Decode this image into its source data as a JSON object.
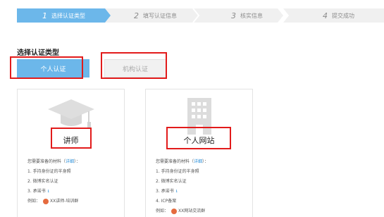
{
  "steps": [
    {
      "num": "1",
      "label": "选择认证类型",
      "active": true
    },
    {
      "num": "2",
      "label": "填写认证信息",
      "active": false
    },
    {
      "num": "3",
      "label": "核实信息",
      "active": false
    },
    {
      "num": "4",
      "label": "提交成功",
      "active": false
    }
  ],
  "colors": {
    "accent": "#6cb7ea",
    "highlight": "#e21b1b",
    "link": "#2b8fd8"
  },
  "section_title": "选择认证类型",
  "type_tabs": {
    "personal": "个人认证",
    "organization": "机构认证"
  },
  "cards": [
    {
      "icon": "graduation-cap-icon",
      "title": "讲师",
      "materials_prefix": "您需要准备的材料（",
      "detail_link": "详细",
      "materials_suffix": "）：",
      "items": [
        "1. 手持身份证的半身照",
        "2. 微博实名认证",
        "3. 承诺书"
      ],
      "example_label": "例如：",
      "example_name": "XX讲师-培训群"
    },
    {
      "icon": "building-icon",
      "title": "个人网站",
      "materials_prefix": "您需要准备的材料（",
      "detail_link": "详细",
      "materials_suffix": "）：",
      "items": [
        "1. 手持身份证的半身照",
        "2. 微博实名认证",
        "3. 承诺书",
        "4. ICP备案"
      ],
      "example_label": "例如：",
      "example_name": "XX网站交流群"
    }
  ]
}
